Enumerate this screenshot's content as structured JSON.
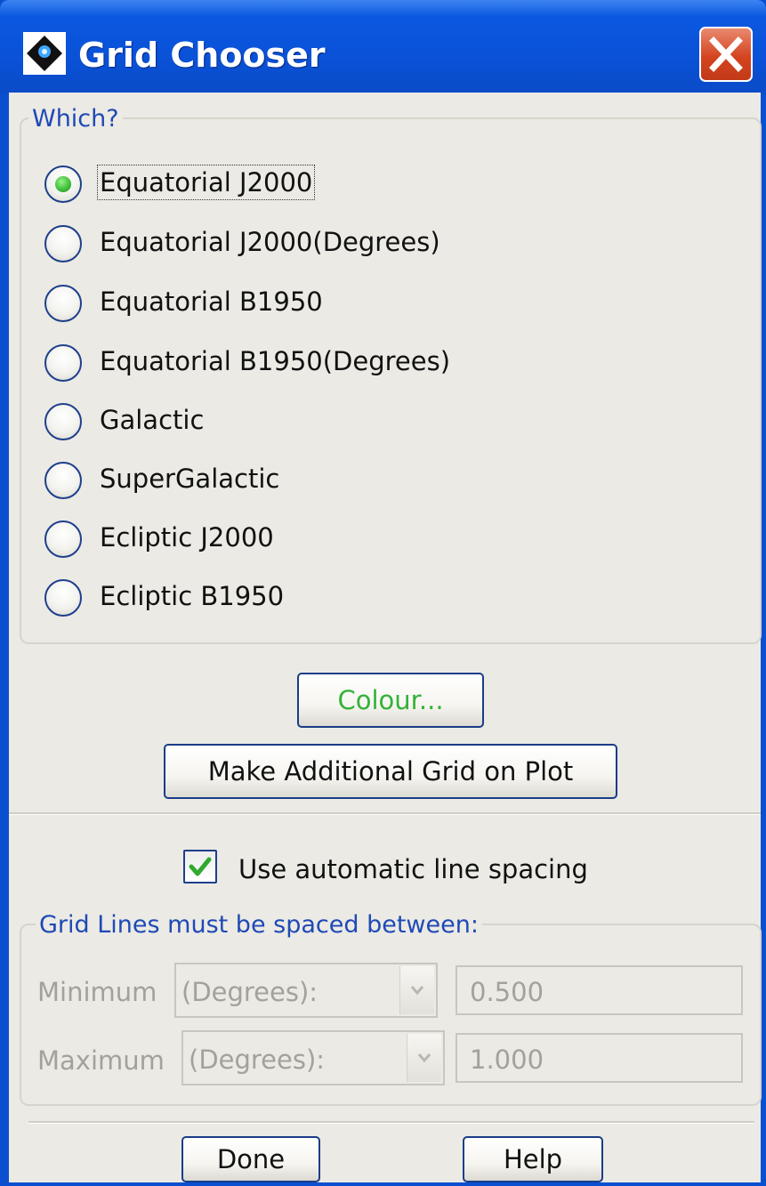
{
  "window": {
    "title": "Grid Chooser",
    "close_icon": "close-icon",
    "app_icon": "app-diamond-icon"
  },
  "which": {
    "legend": "Which?",
    "selected_index": 0,
    "options": [
      "Equatorial J2000",
      "Equatorial J2000(Degrees)",
      "Equatorial B1950",
      "Equatorial B1950(Degrees)",
      "Galactic",
      "SuperGalactic",
      "Ecliptic J2000",
      "Ecliptic B1950"
    ]
  },
  "buttons": {
    "colour": "Colour...",
    "make_grid": "Make Additional Grid on Plot",
    "done": "Done",
    "help": "Help"
  },
  "spacing": {
    "auto_label": "Use automatic line spacing",
    "auto_checked": true,
    "legend": "Grid Lines must be spaced between:",
    "minimum_label": "Minimum",
    "minimum_unit": "(Degrees):",
    "minimum_value": "0.500",
    "maximum_label": "Maximum",
    "maximum_unit": "(Degrees):",
    "maximum_value": "1.000"
  },
  "colors": {
    "accent": "#1f49b6",
    "colour_button_text": "#33b238",
    "title_bar": "#0a52d8",
    "close_button": "#d4441f"
  }
}
